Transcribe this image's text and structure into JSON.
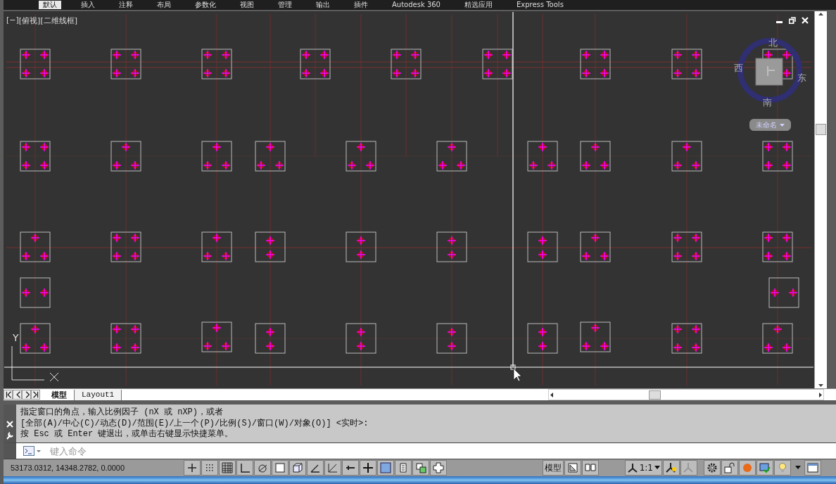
{
  "ribbon_tabs": [
    {
      "label": "默认",
      "selected": true
    },
    {
      "label": "插入",
      "selected": false
    },
    {
      "label": "注释",
      "selected": false
    },
    {
      "label": "布局",
      "selected": false
    },
    {
      "label": "参数化",
      "selected": false
    },
    {
      "label": "视图",
      "selected": false
    },
    {
      "label": "管理",
      "selected": false
    },
    {
      "label": "输出",
      "selected": false
    },
    {
      "label": "插件",
      "selected": false
    },
    {
      "label": "Autodesk 360",
      "selected": false
    },
    {
      "label": "精选应用",
      "selected": false
    },
    {
      "label": "Express Tools",
      "selected": false
    }
  ],
  "viewport": {
    "controls": [
      "[−]",
      "[俯视]",
      "[二维线框]"
    ],
    "compass": {
      "north": "北",
      "east": "东",
      "south": "南",
      "west": "西"
    },
    "named_view": "未命名",
    "ucs": {
      "y_label": "Y"
    }
  },
  "layout_tabs": [
    {
      "label": "模型",
      "selected": true
    },
    {
      "label": "Layout1",
      "selected": false
    }
  ],
  "command_history": [
    "指定窗口的角点，输入比例因子 (nX 或 nXP)，或者",
    "[全部(A)/中心(C)/动态(D)/范围(E)/上一个(P)/比例(S)/窗口(W)/对象(O)] <实时>:",
    "按 Esc 或 Enter 键退出，或单击右键显示快捷菜单。"
  ],
  "command_input": {
    "placeholder": "键入命令"
  },
  "status_bar": {
    "coordinates": "53173.0312, 14348.2782, 0.0000",
    "model_label": "模型",
    "annotation_scale": "1:1"
  }
}
